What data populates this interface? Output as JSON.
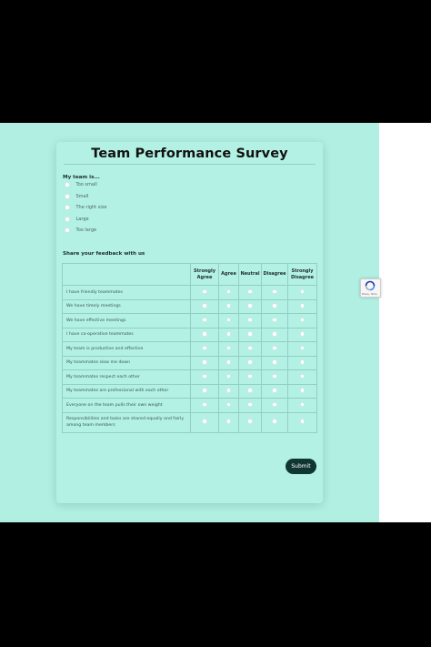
{
  "survey": {
    "title": "Team Performance Survey",
    "question1": {
      "label": "My team is...",
      "options": [
        "Too small",
        "Small",
        "The right size",
        "Large",
        "Too large"
      ]
    },
    "question2": {
      "label": "Share your feedback with us",
      "columns": [
        "Strongly Agree",
        "Agree",
        "Neutral",
        "Disagree",
        "Strongly Disagree"
      ],
      "statements": [
        "I have friendly teammates",
        "We have timely meetings",
        "We have effective meetings",
        "I have co-operative teammates",
        "My team is productive and effective",
        "My teammates slow me down",
        "My teammates respect each other",
        "My teammates are professional with each other",
        "Everyone on the team pulls their own weight",
        "Responsibilities and tasks are shared equally and fairly among team members"
      ]
    },
    "submit_label": "Submit"
  },
  "recaptcha": {
    "icon": "recaptcha-icon",
    "text": "Privacy - Terms"
  },
  "colors": {
    "page_background": "#b0efe2",
    "card_background": "#b3f1e4",
    "submit_button": "#103632"
  }
}
